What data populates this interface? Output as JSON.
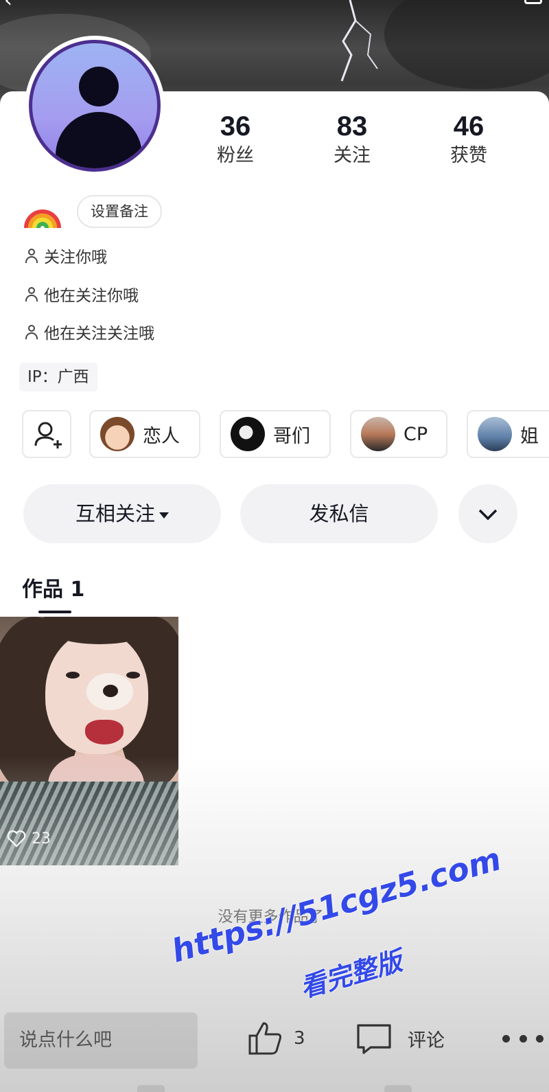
{
  "stats": [
    {
      "value": "36",
      "label": "粉丝"
    },
    {
      "value": "83",
      "label": "关注"
    },
    {
      "value": "46",
      "label": "获赞"
    }
  ],
  "profile": {
    "remark_button": "设置备注",
    "info_lines": [
      "关注你哦",
      "他在关注你哦",
      "他在关注关注哦"
    ],
    "ip_location": "IP：广西"
  },
  "relationships": [
    "恋人",
    "哥们",
    "CP",
    "姐"
  ],
  "actions": {
    "mutual_follow": "互相关注",
    "message": "发私信"
  },
  "tabs": {
    "works": "作品 1"
  },
  "videos": [
    {
      "likes": "23"
    }
  ],
  "no_more_text": "没有更多作品了",
  "watermark": {
    "line1": "https://51cgz5.com",
    "line2": "看完整版"
  },
  "bottom_bar": {
    "comment_placeholder": "说点什么吧",
    "like_count": "3",
    "comment_label": "评论"
  },
  "colors": {
    "accent": "#161823",
    "avatar_ring": "#4c2f8f",
    "watermark": "#3349e8"
  }
}
